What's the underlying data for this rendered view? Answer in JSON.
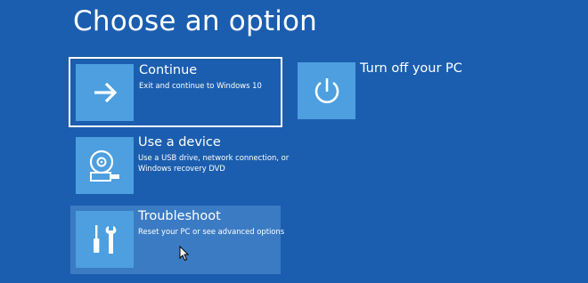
{
  "page": {
    "title": "Choose an option"
  },
  "options": {
    "continue": {
      "title": "Continue",
      "description": "Exit and continue to Windows 10",
      "icon": "arrow-right-icon"
    },
    "device": {
      "title": "Use a device",
      "description": "Use a USB drive, network connection, or Windows recovery DVD",
      "icon": "disc-drive-icon"
    },
    "troubleshoot": {
      "title": "Troubleshoot",
      "description": "Reset your PC or see advanced options",
      "icon": "tools-icon"
    },
    "turn_off": {
      "title": "Turn off your PC",
      "icon": "power-icon"
    }
  },
  "colors": {
    "background": "#1b5eaf",
    "tile": "#4d9fdf",
    "hover": "#3a7bc4",
    "focus_border": "#ffffff"
  }
}
